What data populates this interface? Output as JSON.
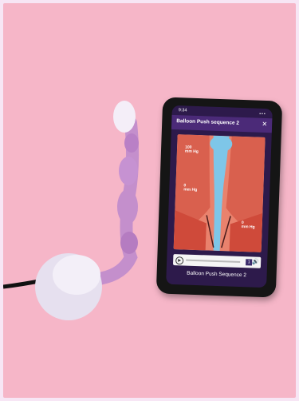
{
  "scene": {
    "background_color": "#f6b6c8",
    "frame_color": "#f7e6f5",
    "device_color": "#c9a6d6",
    "cap_color": "#e6e0ef"
  },
  "phone": {
    "status_time": "9:34",
    "status_icons": "▪▪▪",
    "app_title": "Balloon Push sequence 2",
    "close_icon": "✕",
    "video_labels": [
      {
        "value": "100",
        "unit": "mm Hg"
      },
      {
        "value": "0",
        "unit": "mm Hg"
      },
      {
        "value": "0",
        "unit": "mm Hg"
      }
    ],
    "controls": {
      "play_icon": "▶",
      "speed": "1",
      "volume_icon": "🔊"
    },
    "caption": "Balloon Push Sequence 2"
  }
}
